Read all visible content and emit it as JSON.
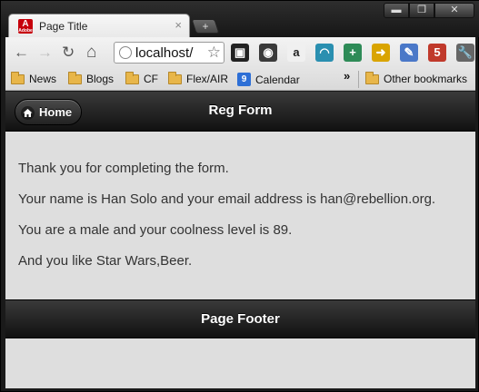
{
  "browser": {
    "tab": {
      "favicon": "adobe-icon",
      "favicon_text": "A",
      "favicon_subtext": "Adobe",
      "title": "Page Title",
      "close": "×"
    },
    "new_tab": "+",
    "window_controls": {
      "minimize": "▬",
      "maximize": "❐",
      "close": "✕"
    },
    "toolbar": {
      "back": "←",
      "forward": "→",
      "reload": "↻",
      "home": "⌂",
      "address": "localhost/",
      "star": "☆",
      "extensions": [
        {
          "name": "evernote-icon",
          "glyph": "▣",
          "color": "#222222"
        },
        {
          "name": "color-wheel-icon",
          "glyph": "◉",
          "color": "#3a3a3a"
        },
        {
          "name": "amazon-icon",
          "glyph": "a",
          "color": "#f0f0f0"
        },
        {
          "name": "signal-icon",
          "glyph": "◠",
          "color": "#2a8fb0"
        },
        {
          "name": "plus-icon",
          "glyph": "+",
          "color": "#2e8b57"
        },
        {
          "name": "send-to-phone-icon",
          "glyph": "➜",
          "color": "#d9a400"
        },
        {
          "name": "eyedropper-icon",
          "glyph": "✎",
          "color": "#4a78c8"
        },
        {
          "name": "html5-database-icon",
          "glyph": "5",
          "color": "#c0392b"
        },
        {
          "name": "wrench-icon",
          "glyph": "🔧",
          "color": "#666666"
        }
      ]
    },
    "bookmarks": {
      "items": [
        {
          "label": "News"
        },
        {
          "label": "Blogs"
        },
        {
          "label": "CF"
        },
        {
          "label": "Flex/AIR"
        },
        {
          "label": "Calendar",
          "icon_text": "9"
        }
      ],
      "overflow": "»",
      "other": "Other bookmarks"
    }
  },
  "page": {
    "header": {
      "home_label": "Home",
      "title": "Reg Form"
    },
    "lines": [
      "Thank you for completing the form.",
      "Your name is Han Solo and your email address is han@rebellion.org.",
      "You are a male and your coolness level is 89.",
      "And you like Star Wars,Beer."
    ],
    "footer": {
      "title": "Page Footer"
    }
  }
}
